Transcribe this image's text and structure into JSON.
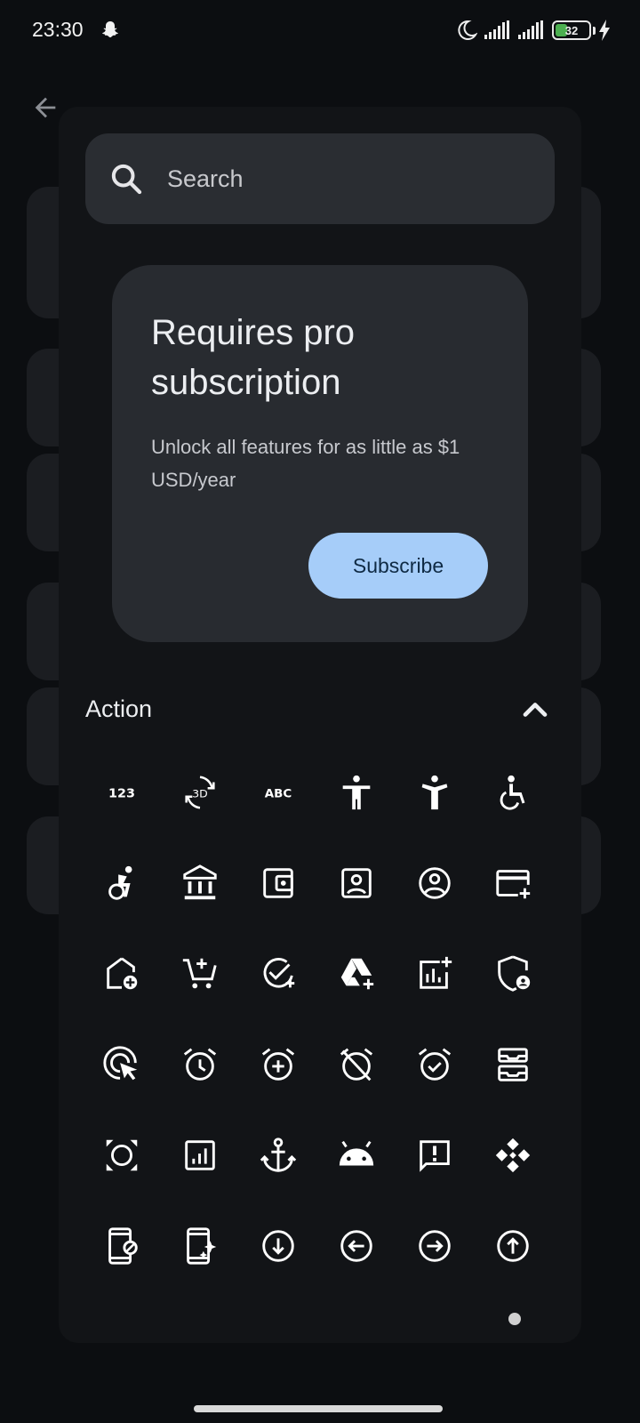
{
  "status_bar": {
    "time": "23:30",
    "battery": "32",
    "icons": [
      "snapchat-icon",
      "moon-icon",
      "signal-icon",
      "signal-icon",
      "battery-icon",
      "charging-icon"
    ]
  },
  "search": {
    "placeholder": "Search"
  },
  "pro_card": {
    "title": "Requires pro subscription",
    "subtitle": "Unlock all features for as little as $1 USD/year",
    "button_label": "Subscribe"
  },
  "section": {
    "title": "Action"
  },
  "icon_glyphs": {
    "numbers": "123",
    "three_d": "3D",
    "abc": "ABC"
  },
  "icons": [
    "123-icon",
    "3d-rotation-icon",
    "abc-icon",
    "accessibility-icon",
    "accessibility-new-icon",
    "accessible-icon",
    "accessible-forward-icon",
    "account-balance-icon",
    "account-balance-wallet-icon",
    "account-box-icon",
    "account-circle-icon",
    "add-card-icon",
    "add-home-icon",
    "add-shopping-cart-icon",
    "add-task-icon",
    "add-to-drive-icon",
    "addchart-icon",
    "admin-panel-settings-icon",
    "ads-click-icon",
    "alarm-icon",
    "alarm-add-icon",
    "alarm-off-icon",
    "alarm-on-icon",
    "all-inbox-icon",
    "all-out-icon",
    "analytics-icon",
    "anchor-icon",
    "android-icon",
    "announcement-icon",
    "api-icon",
    "app-blocking-icon",
    "app-shortcut-icon",
    "arrow-circle-down-icon",
    "arrow-circle-left-icon",
    "arrow-circle-right-icon",
    "arrow-circle-up-icon"
  ],
  "colors": {
    "background": "#0c0e11",
    "dialog": "#121417",
    "card": "#282b30",
    "accent": "#a6cdf9"
  }
}
